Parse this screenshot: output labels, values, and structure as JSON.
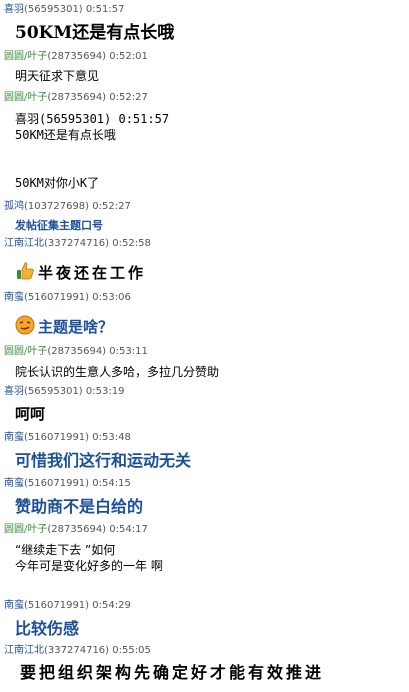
{
  "messages": [
    {
      "name": "喜羽",
      "uid": "(56595301)",
      "time": "0:51:57",
      "text": "50KM还是有点长哦"
    },
    {
      "name": "圆圆/叶子",
      "uid": "(28735694)",
      "time": "0:52:01",
      "text": "明天征求下意见"
    },
    {
      "name": "圆圆/叶子",
      "uid": "(28735694)",
      "time": "0:52:27",
      "lines": [
        "喜羽(56595301)  0:51:57",
        "50KM还是有点长哦",
        "",
        "",
        "50KM对你小K了"
      ]
    },
    {
      "name": "孤鸿",
      "uid": "(103727698)",
      "time": "0:52:27",
      "text": "发帖征集主题口号"
    },
    {
      "name": "江南江北",
      "uid": "(337274716)",
      "time": "0:52:58",
      "text": "半夜还在工作",
      "icon": "thumbs-up-icon"
    },
    {
      "name": "南蛮",
      "uid": "(516071991)",
      "time": "0:53:06",
      "text": "主题是啥？",
      "icon": "smirk-face-icon"
    },
    {
      "name": "圆圆/叶子",
      "uid": "(28735694)",
      "time": "0:53:11",
      "text": "院长认识的生意人多哈，多拉几分赞助"
    },
    {
      "name": "喜羽",
      "uid": "(56595301)",
      "time": "0:53:19",
      "text": "呵呵"
    },
    {
      "name": "南蛮",
      "uid": "(516071991)",
      "time": "0:53:48",
      "text": "可惜我们这行和运动无关"
    },
    {
      "name": "南蛮",
      "uid": "(516071991)",
      "time": "0:54:15",
      "text": "赞助商不是白给的"
    },
    {
      "name": "圆圆/叶子",
      "uid": "(28735694)",
      "time": "0:54:17",
      "lines": [
        "“继续走下去 ”如何",
        "今年可是变化好多的一年 啊"
      ]
    },
    {
      "name": "南蛮",
      "uid": "(516071991)",
      "time": "0:54:29",
      "text": "比较伤感"
    },
    {
      "name": "江南江北",
      "uid": "(337274716)",
      "time": "0:55:05",
      "text": "要把组织架构先确定好才能有效推进"
    }
  ],
  "colors": {
    "blue_name": "#1b4f9c",
    "green_name": "#3a8d3a",
    "text_blue": "#1b4f9c"
  }
}
